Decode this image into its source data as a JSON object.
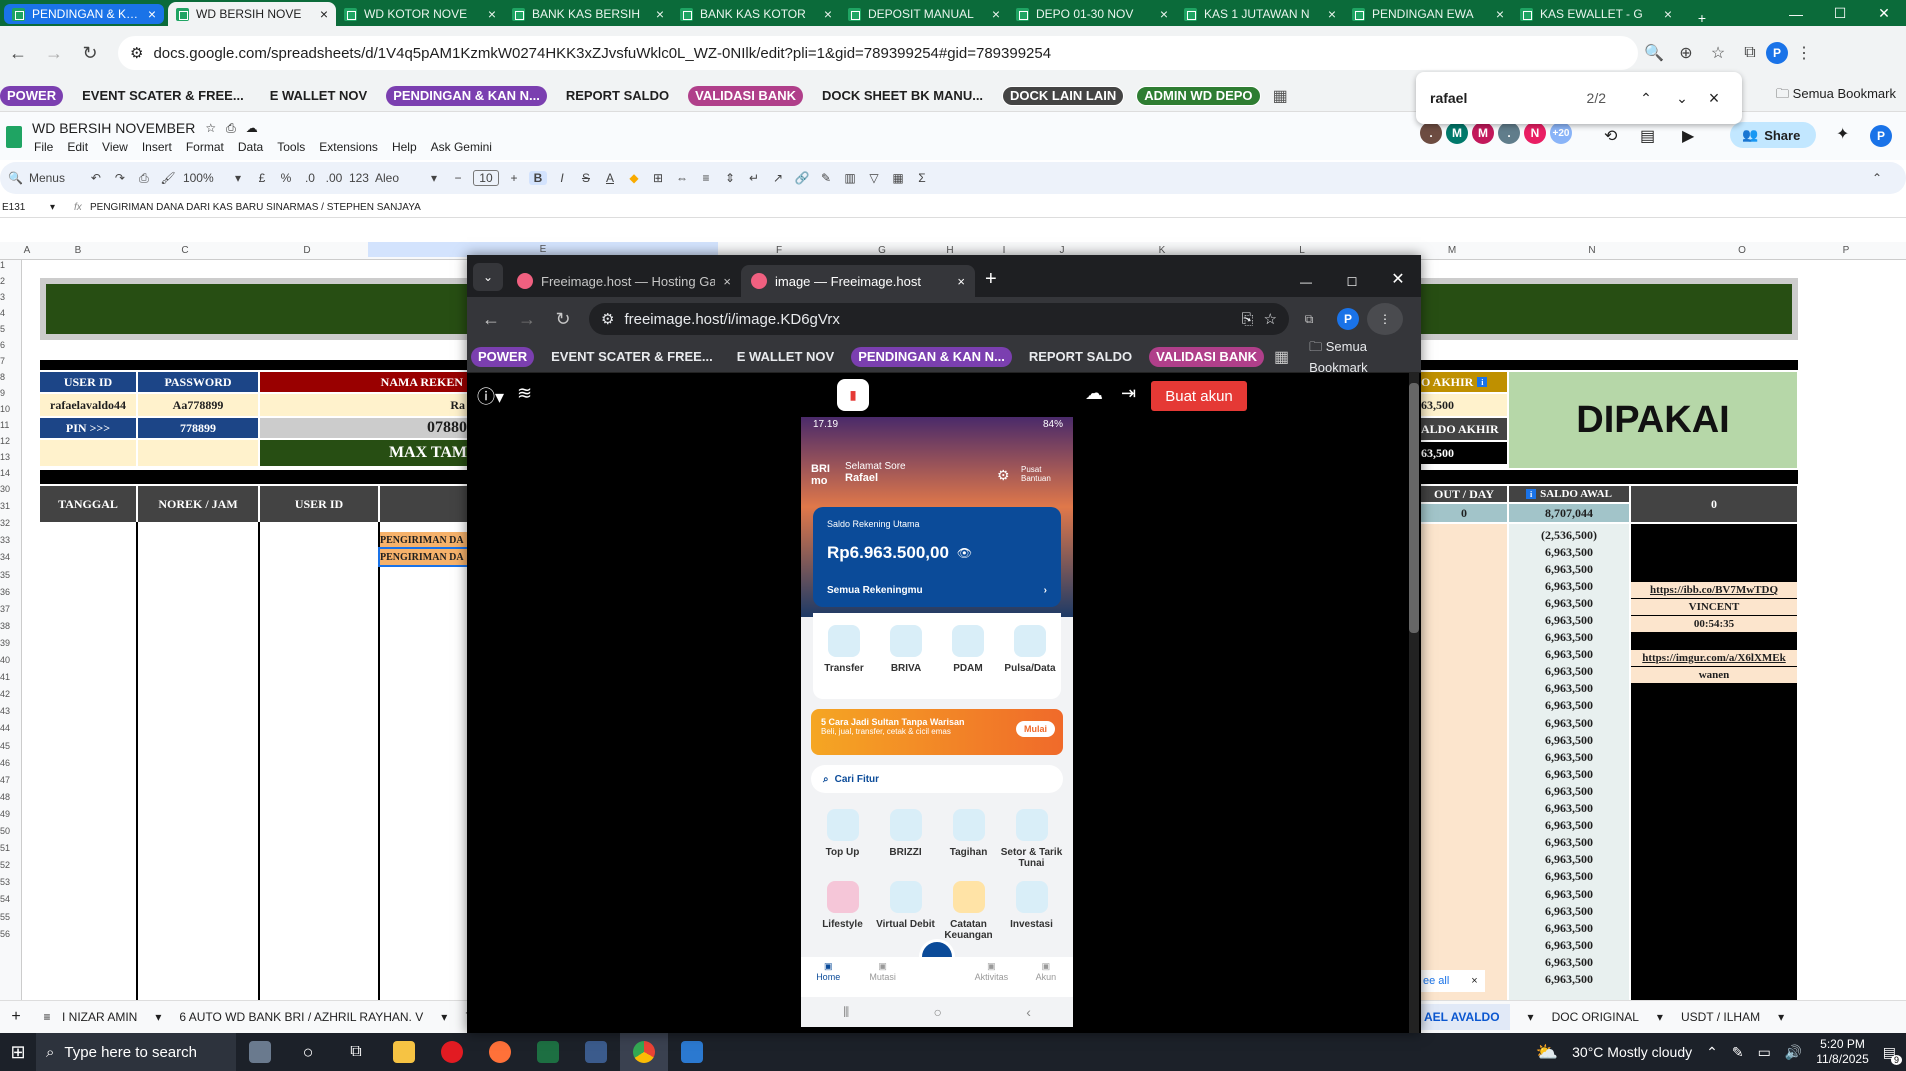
{
  "outer_tabs": [
    {
      "label": "PENDINGAN & KAN N",
      "state": "first"
    },
    {
      "label": "WD BERSIH NOVE",
      "state": "active"
    },
    {
      "label": "WD KOTOR NOVE",
      "state": ""
    },
    {
      "label": "BANK KAS BERSIH",
      "state": ""
    },
    {
      "label": "BANK KAS KOTOR",
      "state": ""
    },
    {
      "label": "DEPOSIT MANUAL",
      "state": ""
    },
    {
      "label": "DEPO 01-30 NOV",
      "state": ""
    },
    {
      "label": "KAS 1 JUTAWAN N",
      "state": ""
    },
    {
      "label": "PENDINGAN EWA",
      "state": ""
    },
    {
      "label": "KAS EWALLET - G",
      "state": ""
    }
  ],
  "outer_url": "docs.google.com/spreadsheets/d/1V4q5pAM1KzmkW0274HKK3xZJvsfuWklc0L_WZ-0NIlk/edit?pli=1&gid=789399254#gid=789399254",
  "bookmarks": [
    {
      "label": "POWER",
      "color": "#7b3fb0"
    },
    {
      "label": "EVENT SCATER & FREE...",
      "color": ""
    },
    {
      "label": "E WALLET NOV",
      "color": ""
    },
    {
      "label": "PENDINGAN & KAN N...",
      "color": "#7b3fb0"
    },
    {
      "label": "REPORT SALDO",
      "color": ""
    },
    {
      "label": "VALIDASI BANK",
      "color": "#b03f8a"
    },
    {
      "label": "DOCK SHEET BK MANU...",
      "color": ""
    },
    {
      "label": "DOCK LAIN LAIN",
      "color": "#444"
    },
    {
      "label": "ADMIN WD DEPO",
      "color": "#2e7d32"
    }
  ],
  "bookmark_folder": "Semua Bookmark",
  "find": {
    "query": "rafael",
    "count": "2/2"
  },
  "sheet": {
    "title": "WD BERSIH NOVEMBER",
    "menu": [
      "File",
      "Edit",
      "View",
      "Insert",
      "Format",
      "Data",
      "Tools",
      "Extensions",
      "Help",
      "Ask Gemini"
    ],
    "share": "Share",
    "avatar_count": "+20",
    "toolbar": {
      "menus": "Menus",
      "zoom": "100%",
      "font": "Aleo",
      "size": "10"
    },
    "cell_ref": "E131",
    "formula": "PENGIRIMAN DANA DARI KAS BARU SINARMAS / STEPHEN SANJAYA",
    "columns": [
      "A",
      "B",
      "C",
      "D",
      "E",
      "F",
      "G",
      "H",
      "I",
      "J",
      "K",
      "L",
      "M",
      "N",
      "O",
      "P"
    ],
    "row_numbers": [
      "1",
      "2",
      "3",
      "4",
      "5",
      "6",
      "7",
      "8",
      "9",
      "10",
      "11",
      "12",
      "13",
      "14",
      "30",
      "31",
      "32",
      "33",
      "34",
      "35",
      "36",
      "37",
      "38",
      "39",
      "40",
      "41",
      "42",
      "43",
      "44",
      "45",
      "46",
      "47",
      "48",
      "49",
      "50",
      "51",
      "52",
      "53",
      "54",
      "55",
      "56"
    ],
    "labels": {
      "user_id": "USER ID",
      "password": "PASSWORD",
      "nama_rek": "NAMA REKEN",
      "user_id_val": "rafaelavaldo44",
      "password_val": "Aa778899",
      "pin_label": "PIN >>>",
      "pin_val": "778899",
      "rek_short": "Ra",
      "rek_num": "07880",
      "max_tam": "MAX TAM",
      "tanggal": "TANGGAL",
      "norek": "NOREK / JAM",
      "user_id2": "USER ID",
      "akhir": "O AKHIR",
      "akhir_val": "63,500",
      "saldo_akhir": "ALDO AKHIR",
      "saldo_akhir_val": "63,500",
      "dipakai": "DIPAKAI",
      "out_day": "OUT / DAY",
      "out_val": "0",
      "saldo_awal": "SALDO AWAL",
      "saldo_awal_val": "8,707,044",
      "zero": "0",
      "pengiriman1": "PENGIRIMAN DA",
      "pengiriman2": "PENGIRIMAN DA",
      "neg": "(2,536,500)",
      "link1": "https://ibb.co/BV7MwTDQ",
      "vincent": "VINCENT",
      "time": "00:54:35",
      "link2": "https://imgur.com/a/X6lXMEk",
      "wanen": "wanen",
      "see_all": "ee all"
    },
    "saldo_rows": [
      "6,963,500",
      "6,963,500",
      "6,963,500",
      "6,963,500",
      "6,963,500",
      "6,963,500",
      "6,963,500",
      "6,963,500",
      "6,963,500",
      "6,963,500",
      "6,963,500",
      "6,963,500",
      "6,963,500",
      "6,963,500",
      "6,963,500",
      "6,963,500",
      "6,963,500",
      "6,963,500",
      "6,963,500",
      "6,963,500",
      "6,963,500",
      "6,963,500",
      "6,963,500",
      "6,963,500",
      "6,963,500",
      "6,963,500"
    ],
    "sheet_tabs": [
      "I NIZAR AMIN",
      "6  AUTO WD BANK BRI / AZHRIL RAYHAN. V",
      "7",
      "AEL AVALDO",
      "DOC ORIGINAL",
      "USDT / ILHAM"
    ]
  },
  "inner": {
    "tabs": [
      "Freeimage.host — Hosting Gam",
      "image — Freeimage.host"
    ],
    "url": "freeimage.host/i/image.KD6gVrx",
    "bookmarks": [
      {
        "label": "POWER",
        "color": "#7b3fb0"
      },
      {
        "label": "EVENT SCATER & FREE...",
        "color": ""
      },
      {
        "label": "E WALLET NOV",
        "color": ""
      },
      {
        "label": "PENDINGAN & KAN N...",
        "color": "#7b3fb0"
      },
      {
        "label": "REPORT SALDO",
        "color": ""
      },
      {
        "label": "VALIDASI BANK",
        "color": "#b03f8a"
      }
    ],
    "bookmark_folder": "Semua Bookmark",
    "buat_akun": "Buat akun"
  },
  "phone": {
    "status_time": "17.19",
    "battery": "84%",
    "greeting": "Selamat Sore",
    "name": "Rafael",
    "bantuan": "Pusat Bantuan",
    "saldo_label": "Saldo Rekening Utama",
    "saldo": "Rp6.963.500,00",
    "semua": "Semua Rekeningmu",
    "quick": [
      "Transfer",
      "BRIVA",
      "PDAM",
      "Pulsa/Data"
    ],
    "promo_title": "5 Cara Jadi Sultan Tanpa Warisan",
    "promo_sub": "Beli, jual, transfer, cetak & cicil emas",
    "promo_btn": "Mulai",
    "search": "Cari Fitur",
    "features": [
      "Top Up",
      "BRIZZI",
      "Tagihan",
      "Setor & Tarik Tunai",
      "Lifestyle",
      "Virtual Debit",
      "Catatan Keuangan",
      "Investasi"
    ],
    "nav": [
      "Home",
      "Mutasi",
      "",
      "Aktivitas",
      "Akun"
    ]
  },
  "taskbar": {
    "search": "Type here to search",
    "weather": "30°C  Mostly cloudy",
    "time": "5:20 PM",
    "date": "11/8/2025",
    "notif": "9"
  }
}
